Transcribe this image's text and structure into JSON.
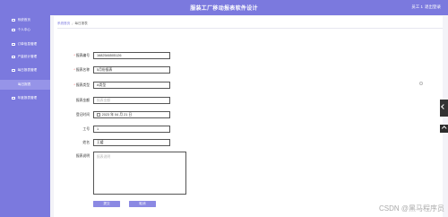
{
  "header": {
    "title": "服装工厂移动报表软件设计",
    "user": "员工 1",
    "logout": "退出登录"
  },
  "sidebar": {
    "items": [
      {
        "label": "系统首页",
        "icon": "home-icon"
      },
      {
        "label": "个人中心",
        "icon": "user-icon"
      },
      {
        "label": "订单信息管理",
        "icon": "list-icon"
      },
      {
        "label": "产量统计管理",
        "icon": "chart-icon"
      },
      {
        "label": "每日报表管理",
        "icon": "report-icon"
      },
      {
        "label": "每日报表",
        "icon": "report-icon",
        "active": true
      },
      {
        "label": "年度报表管理",
        "icon": "report-icon"
      }
    ]
  },
  "breadcrumb": {
    "home": "系统首页",
    "current": "每日报表"
  },
  "form": {
    "report_no": {
      "label": "报表编号",
      "value": "1682546505126"
    },
    "report_name": {
      "label": "报表名称",
      "value": "5月份报表"
    },
    "report_type": {
      "label": "报表类型",
      "value": "A类型"
    },
    "report_amount": {
      "label": "报表金额",
      "placeholder": "报表金额"
    },
    "register_time": {
      "label": "登记时间",
      "value": "2023 年 04 月 21 日"
    },
    "employee_no": {
      "label": "工号",
      "value": "1"
    },
    "name": {
      "label": "姓名",
      "value": "王媛"
    },
    "report_desc": {
      "label": "报表说明",
      "placeholder": "报表说明"
    }
  },
  "buttons": {
    "submit": "提交",
    "cancel": "取消"
  },
  "watermark": "CSDN @黑马程序员"
}
